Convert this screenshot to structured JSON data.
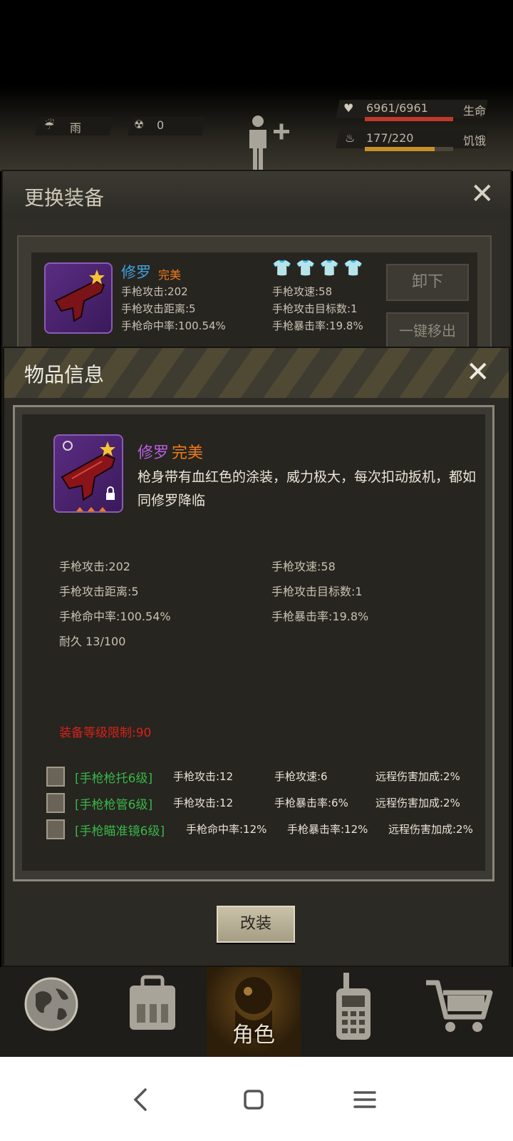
{
  "hud": {
    "weather": "雨",
    "radiation": "0",
    "hp_value": "6961/6961",
    "hp_label": "生命",
    "hunger_value": "177/220",
    "hunger_label": "饥饿"
  },
  "equip_panel": {
    "title": "更换装备",
    "item_name": "修罗",
    "item_quality": "完美",
    "stats_left": [
      "手枪攻击:202",
      "手枪攻击距离:5",
      "手枪命中率:100.54%"
    ],
    "stats_right": [
      "手枪攻速:58",
      "手枪攻击目标数:1",
      "手枪暴击率:19.8%"
    ],
    "unequip_label": "卸下",
    "remove_label": "一键移出"
  },
  "item_info": {
    "title": "物品信息",
    "name": "修罗",
    "quality": "完美",
    "description": "枪身带有血红色的涂装，威力极大，每次扣动扳机，都如同修罗降临",
    "stats_left": [
      "手枪攻击:202",
      "手枪攻击距离:5",
      "手枪命中率:100.54%",
      "耐久 13/100"
    ],
    "stats_right": [
      "手枪攻速:58",
      "手枪攻击目标数:1",
      "手枪暴击率:19.8%"
    ],
    "level_req": "装备等级限制:90",
    "mods": [
      {
        "name": "[手枪枪托6级]",
        "s1": "手枪攻击:12",
        "s2": "手枪攻速:6",
        "s3": "远程伤害加成:2%"
      },
      {
        "name": "[手枪枪管6级]",
        "s1": "手枪攻击:12",
        "s2": "手枪暴击率:6%",
        "s3": "远程伤害加成:2%"
      },
      {
        "name": "[手枪瞄准镜6级]",
        "s1": "手枪命中率:12%",
        "s2": "手枪暴击率:12%",
        "s3": "远程伤害加成:2%"
      }
    ],
    "modify_label": "改装"
  },
  "nav": {
    "active_label": "角色",
    "items": [
      "world-map-icon",
      "backpack-icon",
      "character-icon",
      "radio-icon",
      "shop-cart-icon"
    ]
  },
  "colors": {
    "quality_orange": "#f07a1c",
    "name_purple": "#b85ee0",
    "req_red": "#d8201a",
    "mod_green": "#39b54a",
    "hp_red": "#c0392b",
    "hunger_gold": "#c8902a"
  }
}
